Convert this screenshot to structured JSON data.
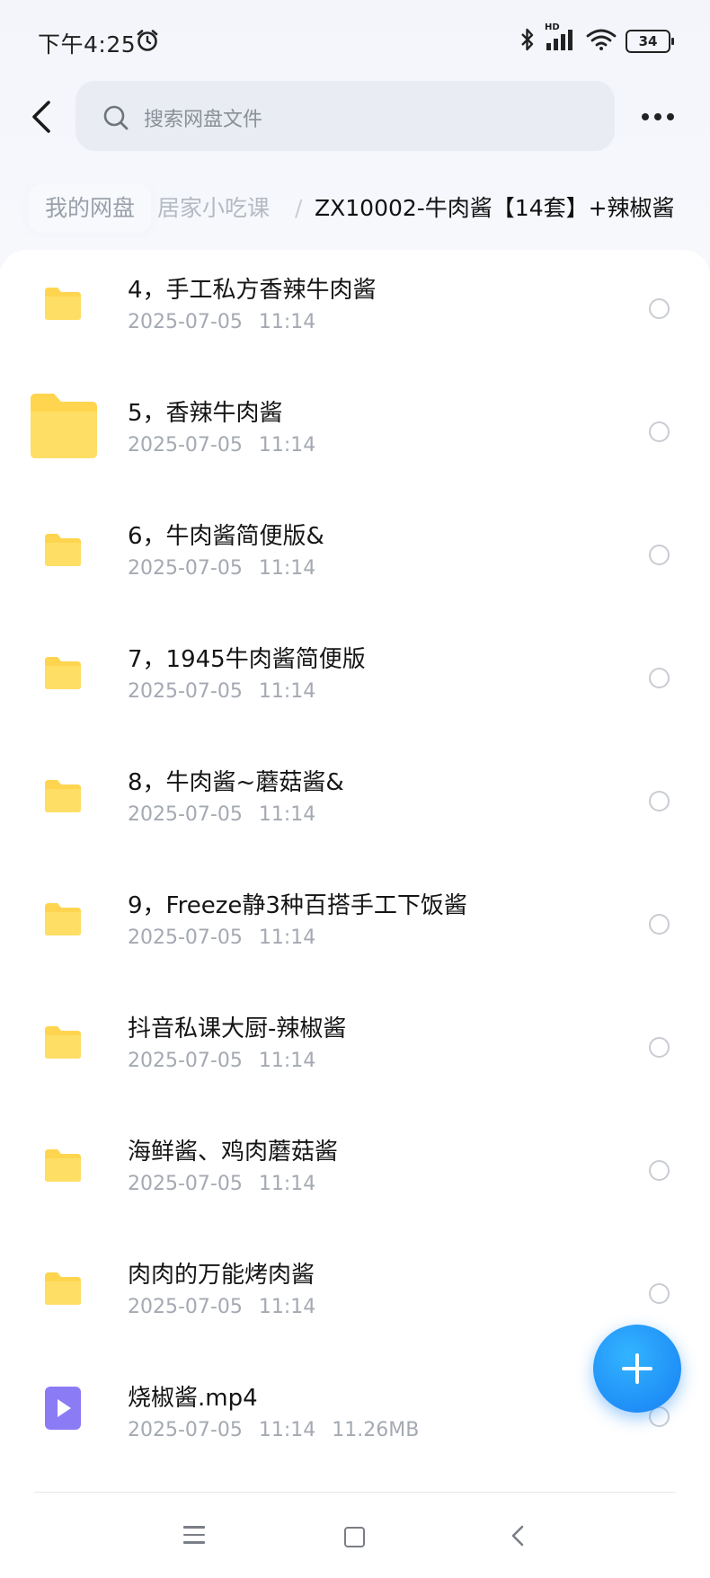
{
  "status_bar": {
    "time": "下午4:25",
    "battery": "34",
    "network": "HD"
  },
  "header": {
    "search_placeholder": "搜索网盘文件"
  },
  "breadcrumb": {
    "items": [
      "我的网盘",
      "居家小吃课",
      "ZX10002-牛肉酱【14套】+辣椒酱"
    ],
    "separator": "/"
  },
  "files": [
    {
      "name": "4，手工私方香辣牛肉酱",
      "date": "2025-07-05",
      "time": "11:14",
      "type": "folder"
    },
    {
      "name": "5，香辣牛肉酱",
      "date": "2025-07-05",
      "time": "11:14",
      "type": "folder"
    },
    {
      "name": "6，牛肉酱简便版&",
      "date": "2025-07-05",
      "time": "11:14",
      "type": "folder"
    },
    {
      "name": "7，1945牛肉酱简便版",
      "date": "2025-07-05",
      "time": "11:14",
      "type": "folder"
    },
    {
      "name": "8，牛肉酱~蘑菇酱&",
      "date": "2025-07-05",
      "time": "11:14",
      "type": "folder"
    },
    {
      "name": "9，Freeze静3种百搭手工下饭酱",
      "date": "2025-07-05",
      "time": "11:14",
      "type": "folder"
    },
    {
      "name": "抖音私课大厨-辣椒酱",
      "date": "2025-07-05",
      "time": "11:14",
      "type": "folder"
    },
    {
      "name": "海鲜酱、鸡肉蘑菇酱",
      "date": "2025-07-05",
      "time": "11:14",
      "type": "folder"
    },
    {
      "name": "肉肉的万能烤肉酱",
      "date": "2025-07-05",
      "time": "11:14",
      "type": "folder"
    },
    {
      "name": "烧椒酱.mp4",
      "date": "2025-07-05",
      "time": "11:14",
      "size": "11.26MB",
      "type": "video"
    }
  ],
  "colors": {
    "folder": "#ffd54f",
    "video": "#8b7cf6",
    "fab": "#1f8ff7"
  }
}
